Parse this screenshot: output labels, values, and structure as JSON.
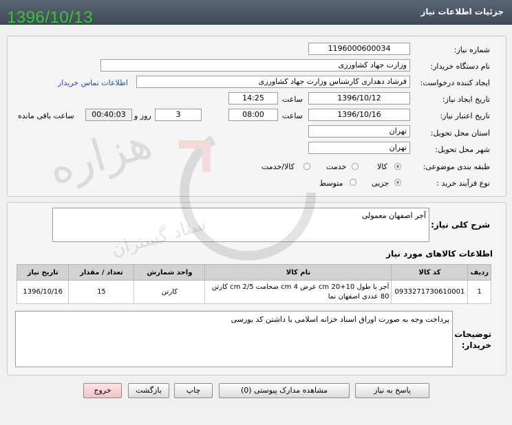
{
  "header": {
    "title": "جزئیات اطلاعات نیاز",
    "date_stamp": "1396/10/13"
  },
  "form": {
    "need_number_label": "شماره نیاز:",
    "need_number": "1196000600034",
    "buyer_org_label": "نام دستگاه خریدار:",
    "buyer_org": "وزارت جهاد کشاورزی",
    "requester_label": "ایجاد کننده درخواست:",
    "requester": "فرشاد دهداری کارشناس  وزارت جهاد کشاورزی",
    "contact_link": "اطلاعات تماس خریدار",
    "created_label": "تاریخ ایجاد نیاز:",
    "created_date": "1396/10/12",
    "time_label": "ساعت",
    "created_time": "14:25",
    "validity_label": "تاریخ اعتبار نیاز:",
    "validity_date": "1396/10/16",
    "validity_time": "08:00",
    "days_value": "3",
    "days_label": "روز و",
    "remaining_time": "00:40:03",
    "remaining_label": "ساعت باقی مانده",
    "province_label": "استان محل تحویل:",
    "province": "تهران",
    "city_label": "شهر محل تحویل:",
    "city": "تهران",
    "category_label": "طبقه بندی موضوعی:",
    "category_options": [
      "کالا",
      "خدمت",
      "کالا/خدمت"
    ],
    "process_label": "نوع فرآیند خرید :",
    "process_options": [
      "جزیی",
      "متوسط"
    ]
  },
  "summary": {
    "label": "شرح کلی نیاز:",
    "text": "آجر اصفهان معمولی"
  },
  "items": {
    "section_title": "اطلاعات کالاهای مورد نیاز",
    "columns": [
      "ردیف",
      "کد کالا",
      "نام کالا",
      "واحد شمارش",
      "تعداد / مقدار",
      "تاریخ نیاز"
    ],
    "rows": [
      {
        "row": "1",
        "code": "0933271730610001",
        "name": "آجر با طول 10+20 cm عرض 4 cm ضخامت 2/5 cm کارتن 80 عددی اصفهان نما",
        "unit": "کارتن",
        "qty": "15",
        "date": "1396/10/16"
      }
    ]
  },
  "notes": {
    "label": "توضیحات خریدار:",
    "text": "پرداخت وجه  به صورت اوراق  اسناد خزانه اسلامی با داشتن کد بورسی"
  },
  "buttons": {
    "reply": "پاسخ به نیاز",
    "attachments": "مشاهده مدارک پیوستی (0)",
    "print": "چاپ",
    "back": "بازگشت",
    "exit": "خروج"
  },
  "watermark": {
    "text": "هزاره",
    "subtext": "ستاد گستران"
  }
}
